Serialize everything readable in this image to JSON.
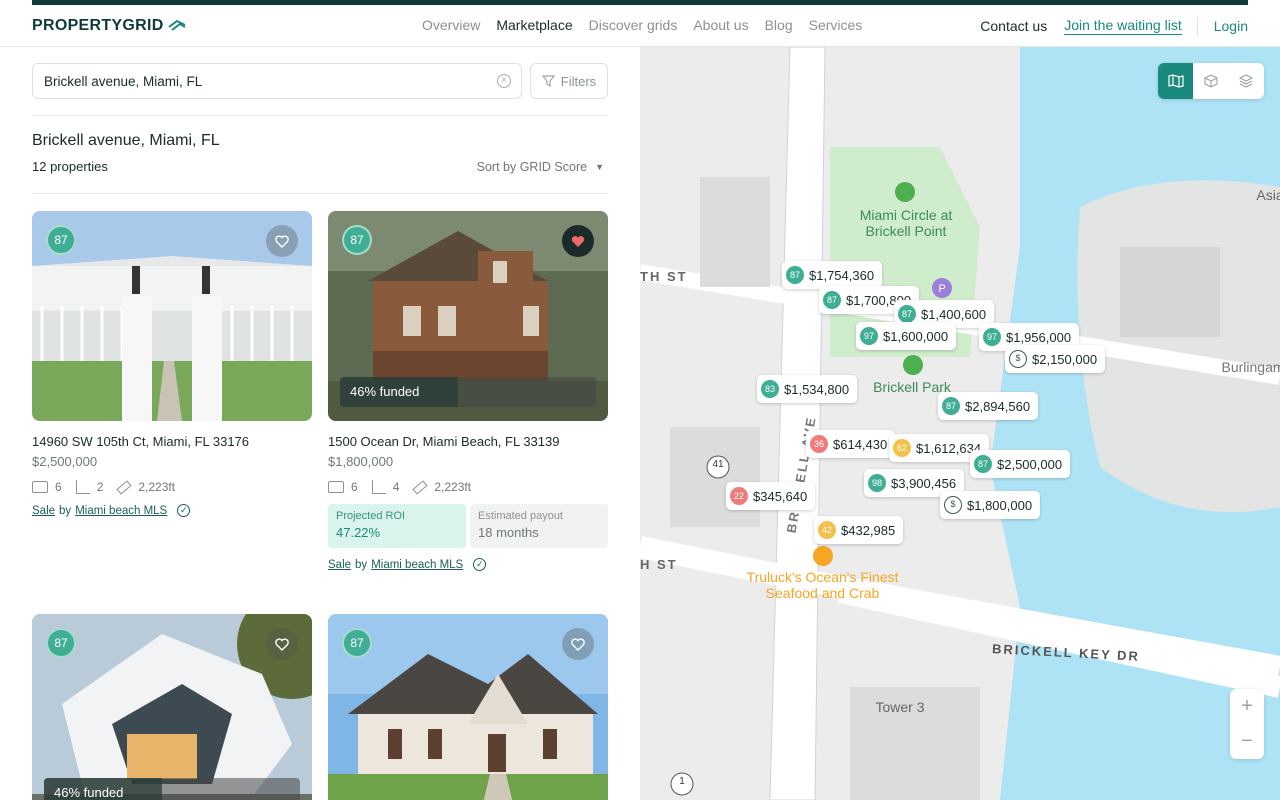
{
  "header": {
    "logo": "PROPERTYGRID",
    "nav": [
      "Overview",
      "Marketplace",
      "Discover grids",
      "About us",
      "Blog",
      "Services"
    ],
    "active_nav": "Marketplace",
    "contact": "Contact us",
    "join": "Join the waiting list",
    "login": "Login"
  },
  "search": {
    "value": "Brickell avenue, Miami, FL",
    "filters_label": "Filters"
  },
  "results": {
    "title": "Brickell avenue, Miami, FL",
    "count": "12 properties",
    "sort": "Sort by GRID Score"
  },
  "cards": [
    {
      "score": "87",
      "favorite": false,
      "address": "14960 SW 105th Ct, Miami, FL 33176",
      "price": "$2,500,000",
      "beds": "6",
      "baths": "2",
      "area": "2,223ft",
      "sale_prefix": "Sale",
      "sale_by": "by",
      "sale_source": "Miami beach MLS"
    },
    {
      "score": "87",
      "favorite": true,
      "funded": "46% funded",
      "funded_fraction": 0.46,
      "address": "1500 Ocean Dr, Miami Beach, FL 33139",
      "price": "$1,800,000",
      "beds": "6",
      "baths": "4",
      "area": "2,223ft",
      "roi_label": "Projected ROI",
      "roi_value": "47.22%",
      "payout_label": "Estimated payout",
      "payout_value": "18  months",
      "sale_prefix": "Sale",
      "sale_by": "by",
      "sale_source": "Miami beach MLS"
    },
    {
      "score": "87",
      "favorite": false,
      "funded": "46% funded",
      "funded_fraction": 0.46
    },
    {
      "score": "87",
      "favorite": false
    }
  ],
  "map": {
    "labels": {
      "park1": "Miami Circle at Brickell Point",
      "park2": "Brickell Park",
      "restaurant": "Truluck's Ocean's Finest Seafood and Crab",
      "street1": "BRICKELL KEY DR",
      "street2": "BRICKELL AVE",
      "tower": "Tower 3",
      "asia": "Asia",
      "burlingame": "Burlingam",
      "st_top": "TH ST",
      "st_bottom": "H ST",
      "route41": "41",
      "route1": "1"
    },
    "pins": [
      {
        "score": "87",
        "price": "$1,754,360",
        "color": "#3fae95"
      },
      {
        "score": "87",
        "price": "$1,700,800",
        "color": "#3fae95"
      },
      {
        "score": "87",
        "price": "$1,400,600",
        "color": "#3fae95"
      },
      {
        "score": "97",
        "price": "$1,600,000",
        "color": "#3fae95"
      },
      {
        "score": "97",
        "price": "$1,956,000",
        "color": "#3fae95"
      },
      {
        "score": "",
        "price": "$2,150,000",
        "color": "#ffffff",
        "icon": "money-bag-icon"
      },
      {
        "score": "83",
        "price": "$1,534,800",
        "color": "#3fae95"
      },
      {
        "score": "87",
        "price": "$2,894,560",
        "color": "#3fae95"
      },
      {
        "score": "36",
        "price": "$614,430",
        "color": "#f07b7b"
      },
      {
        "score": "62",
        "price": "$1,612,634",
        "color": "#f3c04a"
      },
      {
        "score": "87",
        "price": "$2,500,000",
        "color": "#3fae95"
      },
      {
        "score": "98",
        "price": "$3,900,456",
        "color": "#3fae95"
      },
      {
        "score": "22",
        "price": "$345,640",
        "color": "#f07b7b"
      },
      {
        "score": "",
        "price": "$1,800,000",
        "color": "#ffffff",
        "icon": "money-bag-icon"
      },
      {
        "score": "42",
        "price": "$432,985",
        "color": "#f3c04a"
      }
    ],
    "zoom_in": "+",
    "zoom_out": "−"
  }
}
